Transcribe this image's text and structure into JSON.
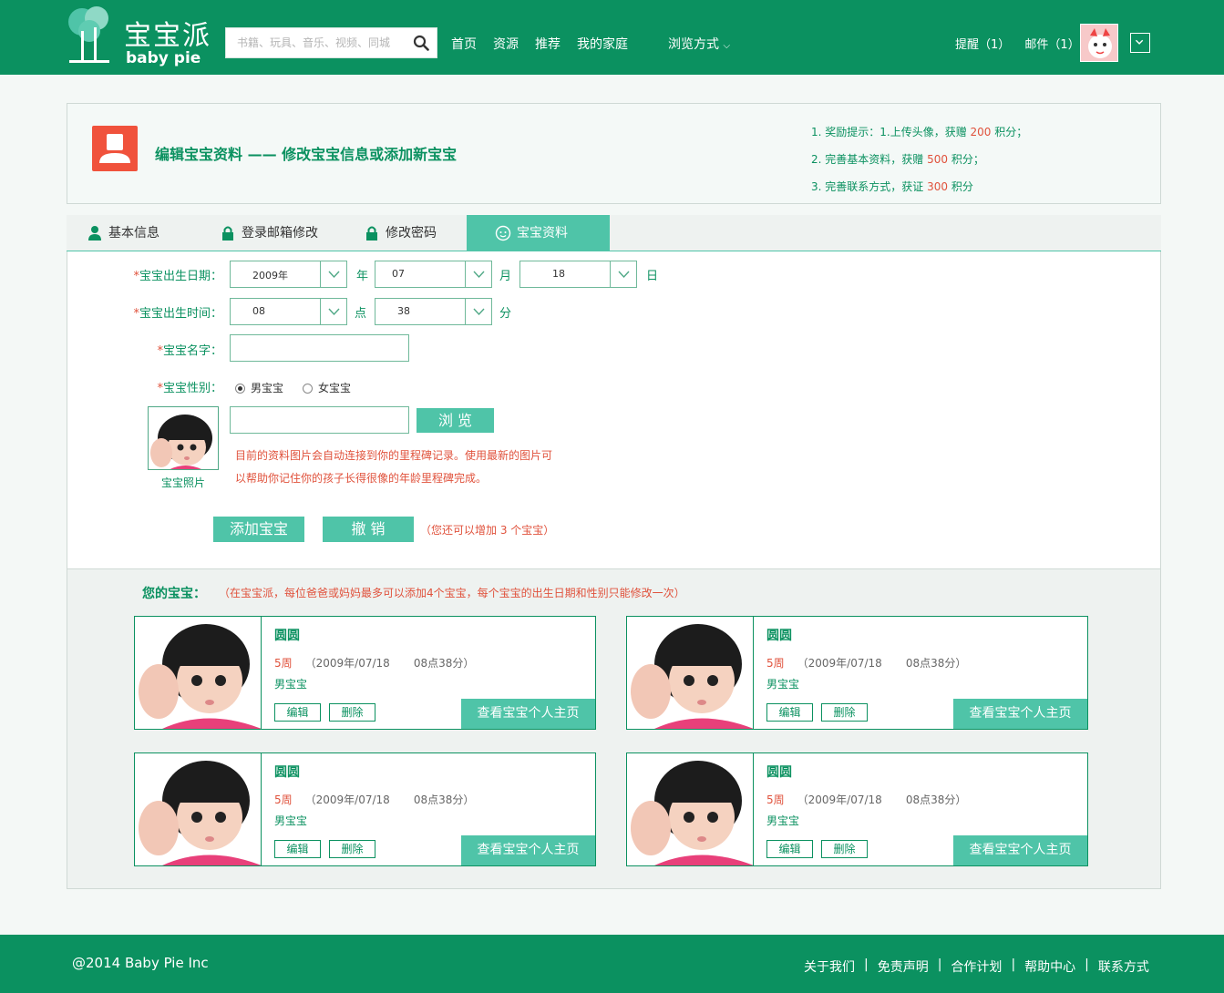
{
  "header": {
    "logo_cn": "宝宝派",
    "logo_en": "baby pie",
    "search_placeholder": "书籍、玩具、音乐、视频、同城",
    "nav": [
      "首页",
      "资源",
      "推荐",
      "我的家庭"
    ],
    "browse": "浏览方式",
    "remind": "提醒（1）",
    "mail": "邮件（1）"
  },
  "panel": {
    "title": "编辑宝宝资料 —— 修改宝宝信息或添加新宝宝",
    "tips": [
      {
        "pre": "1.  奖励提示：1.上传头像，获赠 ",
        "num": "200",
        "post": " 积分；"
      },
      {
        "pre": "2.  完善基本资料，获赠 ",
        "num": "500",
        "post": " 积分；"
      },
      {
        "pre": "3.  完善联系方式，获证 ",
        "num": "300",
        "post": " 积分"
      }
    ]
  },
  "tabs": [
    "基本信息",
    "登录邮箱修改",
    "修改密码",
    "宝宝资料"
  ],
  "form": {
    "birth_date_label": "宝宝出生日期：",
    "year": "2009年",
    "year_unit": "年",
    "month": "07",
    "month_unit": "月",
    "day": "18",
    "day_unit": "日",
    "birth_time_label": "宝宝出生时间：",
    "hour": "08",
    "hour_unit": "点",
    "minute": "38",
    "minute_unit": "分",
    "name_label": "宝宝名字：",
    "gender_label": "宝宝性别：",
    "gender_male": "男宝宝",
    "gender_female": "女宝宝",
    "photo_caption": "宝宝照片",
    "browse_button": "浏  览",
    "notice": "目前的资料图片会自动连接到你的里程碑记录。使用最新的图片可以帮助你记住你的孩子长得很像的年龄里程碑完成。",
    "add_button": "添加宝宝",
    "cancel_button": "撤  销",
    "remain": "（您还可以增加 3 个宝宝）"
  },
  "list": {
    "title": "您的宝宝：",
    "note": "（在宝宝派，每位爸爸或妈妈最多可以添加4个宝宝，每个宝宝的出生日期和性别只能修改一次）",
    "babies": [
      {
        "name": "圆圆",
        "weeks": "5周",
        "date": "（2009年/07/18",
        "time": "08点38分）",
        "sex": "男宝宝",
        "edit": "编辑",
        "del": "删除",
        "home": "查看宝宝个人主页"
      },
      {
        "name": "圆圆",
        "weeks": "5周",
        "date": "（2009年/07/18",
        "time": "08点38分）",
        "sex": "男宝宝",
        "edit": "编辑",
        "del": "删除",
        "home": "查看宝宝个人主页"
      },
      {
        "name": "圆圆",
        "weeks": "5周",
        "date": "（2009年/07/18",
        "time": "08点38分）",
        "sex": "男宝宝",
        "edit": "编辑",
        "del": "删除",
        "home": "查看宝宝个人主页"
      },
      {
        "name": "圆圆",
        "weeks": "5周",
        "date": "（2009年/07/18",
        "time": "08点38分）",
        "sex": "男宝宝",
        "edit": "编辑",
        "del": "删除",
        "home": "查看宝宝个人主页"
      }
    ]
  },
  "footer": {
    "copyright": "@2014 Baby Pie Inc",
    "links": [
      "关于我们",
      "免责声明",
      "合作计划",
      "帮助中心",
      "联系方式"
    ]
  },
  "colors": {
    "brand": "#0b9160",
    "accent": "#4fc4a8",
    "alert": "#e0523c"
  }
}
